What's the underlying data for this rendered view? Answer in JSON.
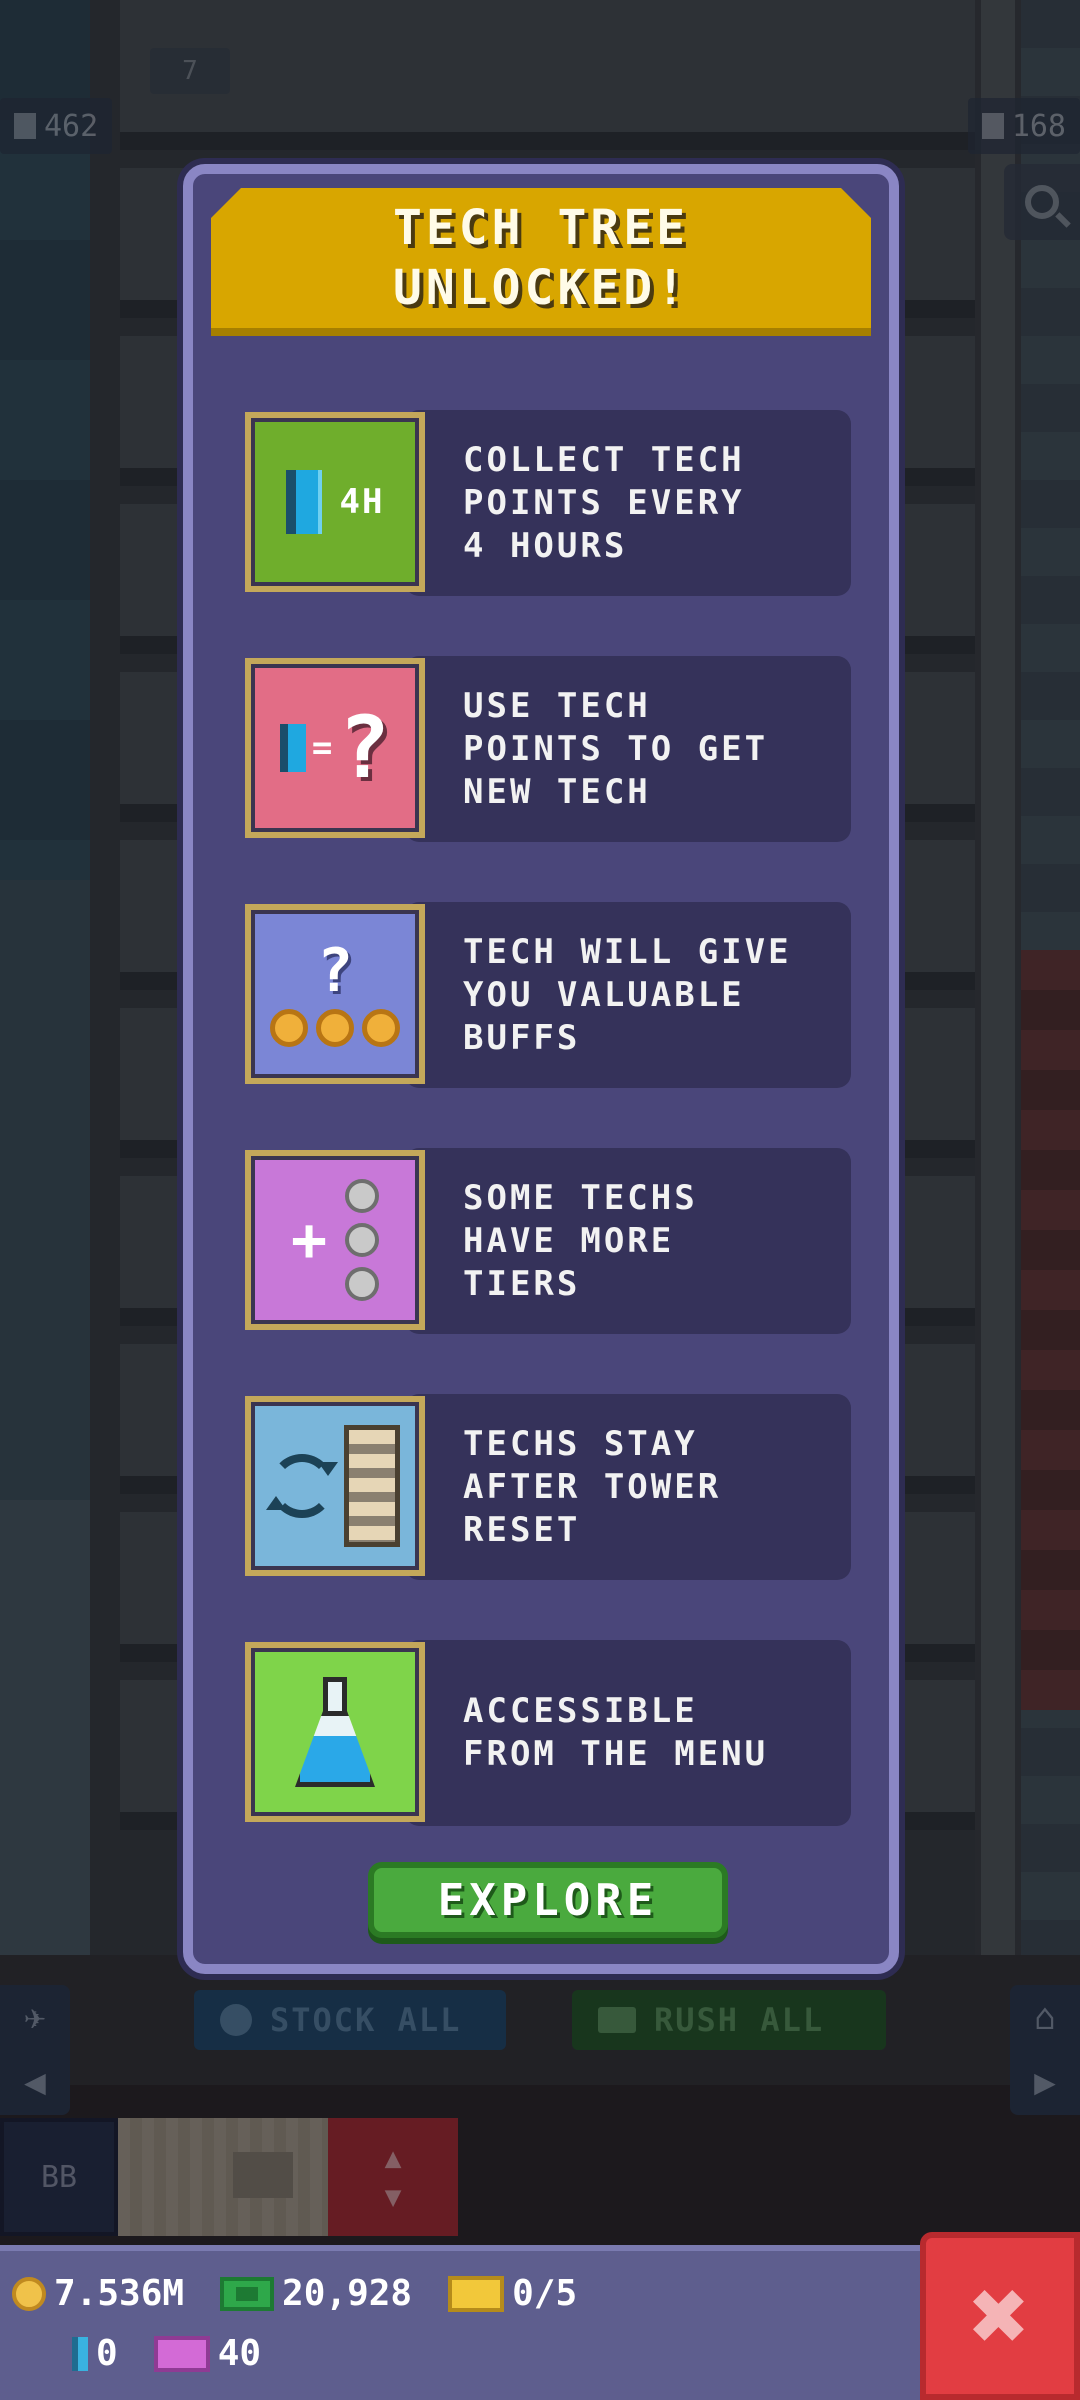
{
  "top_bar": {
    "population": "462",
    "floors": "168",
    "elevator_floor": "7"
  },
  "modal": {
    "title_line1": "TECH TREE",
    "title_line2": "UNLOCKED!",
    "items": [
      {
        "icon": "tech-points-4h-icon",
        "tile_label": "4H",
        "text": [
          "COLLECT TECH",
          "POINTS EVERY",
          "4 HOURS"
        ],
        "tile_color": "#6fae2c"
      },
      {
        "icon": "tech-points-equals-question-icon",
        "text": [
          "USE TECH",
          "POINTS TO GET",
          "NEW TECH"
        ],
        "tile_color": "#e26d86"
      },
      {
        "icon": "question-coins-icon",
        "text": [
          "TECH WILL GIVE",
          "YOU VALUABLE",
          "BUFFS"
        ],
        "tile_color": "#7b86d6"
      },
      {
        "icon": "plus-tiers-icon",
        "text": [
          "SOME TECHS",
          "HAVE MORE",
          "TIERS"
        ],
        "tile_color": "#c878d8"
      },
      {
        "icon": "cycle-building-icon",
        "text": [
          "TECHS STAY",
          "AFTER TOWER",
          "RESET"
        ],
        "tile_color": "#7ab6da"
      },
      {
        "icon": "flask-icon",
        "text": [
          "ACCESSIBLE",
          "FROM THE MENU"
        ],
        "tile_color": "#7fd44a"
      }
    ],
    "explore_label": "EXPLORE"
  },
  "actions": {
    "stock_all": "STOCK ALL",
    "rush_all": "RUSH ALL"
  },
  "elevator": {
    "bb_label": "BB"
  },
  "currency": {
    "coins": "7.536M",
    "bux": "20,928",
    "tickets": "0/5",
    "tech_points": "0",
    "legend_tickets": "40"
  },
  "colors": {
    "modal_bg": "#4a467a",
    "header_gold": "#d8a600",
    "explore_green": "#4aaa3e",
    "close_red": "#e23d42"
  }
}
